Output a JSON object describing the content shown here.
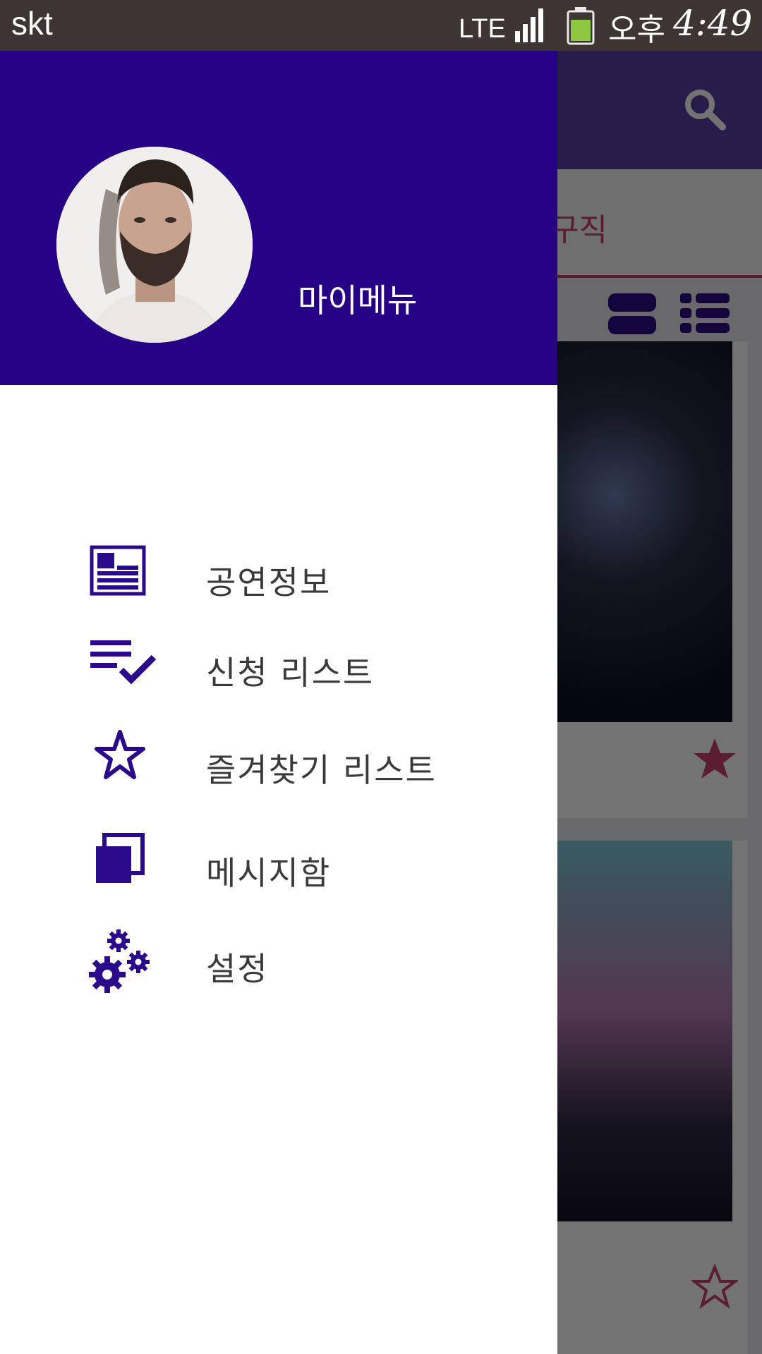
{
  "status_bar": {
    "carrier": "skt",
    "network": "LTE",
    "ampm": "오후",
    "time": "4:49"
  },
  "background_app": {
    "tab_partial_label": "구직"
  },
  "drawer": {
    "header_title": "마이메뉴",
    "items": [
      {
        "label": "공연정보",
        "icon": "news-icon"
      },
      {
        "label": "신청 리스트",
        "icon": "playlist-check-icon"
      },
      {
        "label": "즐겨찾기 리스트",
        "icon": "star-outline-icon"
      },
      {
        "label": "메시지함",
        "icon": "copy-icon"
      },
      {
        "label": "설정",
        "icon": "gears-icon"
      }
    ]
  },
  "colors": {
    "drawer_header": "#260085",
    "accent": "#c7426e",
    "icon": "#2a0a8a"
  }
}
